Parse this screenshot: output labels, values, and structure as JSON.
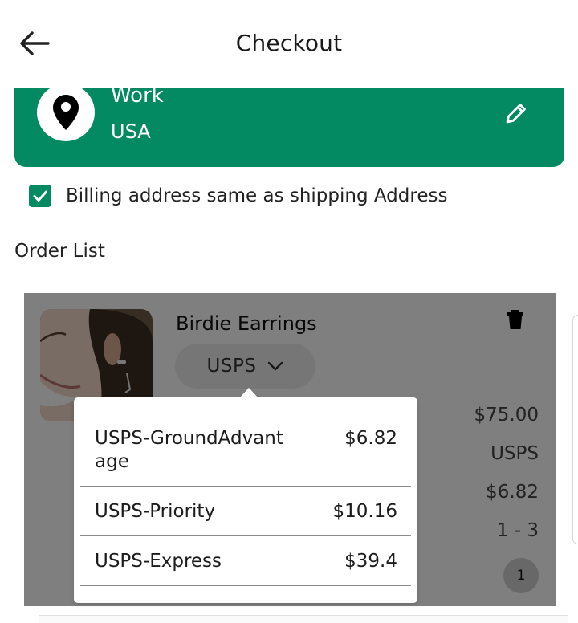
{
  "header": {
    "title": "Checkout",
    "back_icon": "arrow-left-icon"
  },
  "address": {
    "name": "Work",
    "country": "USA",
    "pin_icon": "location-pin-icon",
    "edit_icon": "pencil-icon",
    "color": "#038a63"
  },
  "billing": {
    "checked": true,
    "label": "Billing address same as shipping Address"
  },
  "order_list": {
    "heading": "Order List",
    "items": [
      {
        "name": "Birdie Earrings",
        "shipping_select": "USPS",
        "price": "$75.00",
        "carrier": "USPS",
        "shipping_cost": "$6.82",
        "delivery_days": "1 - 3",
        "quantity": "1",
        "delete_icon": "trash-icon"
      }
    ]
  },
  "shipping_popup": {
    "options": [
      {
        "name": "USPS-GroundAdvantage",
        "price": "$6.82"
      },
      {
        "name": "USPS-Priority",
        "price": "$10.16"
      },
      {
        "name": "USPS-Express",
        "price": "$39.4"
      }
    ]
  }
}
